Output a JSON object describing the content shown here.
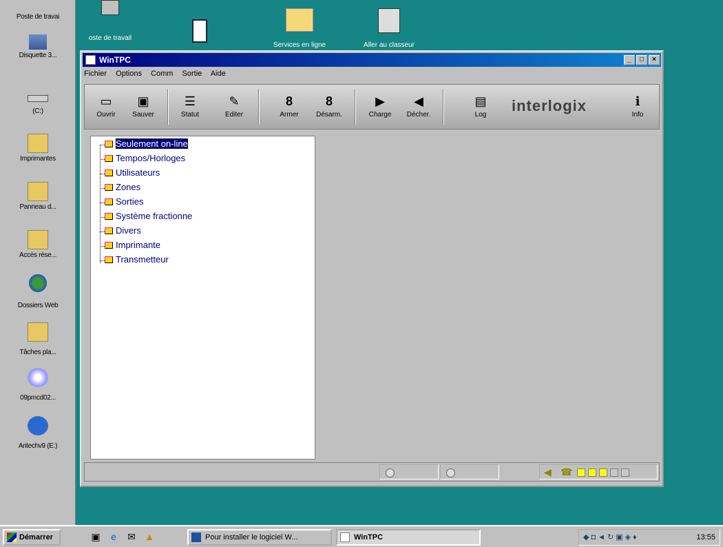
{
  "desktop_icons": [
    {
      "label": "Poste de travai",
      "icon": "computer-icon"
    },
    {
      "label": "Disquette 3...",
      "icon": "floppy-icon"
    },
    {
      "label": "(C:)",
      "icon": "drive-icon"
    },
    {
      "label": "Imprimantes",
      "icon": "printers-icon"
    },
    {
      "label": "Panneau d...",
      "icon": "control-panel-icon"
    },
    {
      "label": "Accès rése...",
      "icon": "network-icon"
    },
    {
      "label": "Dossiers Web",
      "icon": "web-folders-icon"
    },
    {
      "label": "Tâches pla...",
      "icon": "scheduled-tasks-icon"
    },
    {
      "label": "09pmcd02...",
      "icon": "cd-icon"
    },
    {
      "label": "Aritechv9 (E:)",
      "icon": "aritech-drive-icon"
    }
  ],
  "top_icons": [
    {
      "label": "oste de travail",
      "icon": "computer-icon"
    },
    {
      "label": "",
      "icon": "tool-icon"
    },
    {
      "label": "Services en ligne",
      "icon": "folder-icon"
    },
    {
      "label": "Aller au classeur",
      "icon": "briefcase-icon"
    }
  ],
  "window": {
    "title": "WinTPC",
    "menu": [
      "Fichier",
      "Options",
      "Comm",
      "Sortie",
      "Aide"
    ],
    "toolbar": [
      {
        "label": "Ouvrir",
        "glyph": "▭"
      },
      {
        "label": "Sauver",
        "glyph": "▣"
      },
      {
        "label": "Statut",
        "glyph": "☰"
      },
      {
        "label": "Editer",
        "glyph": "✎"
      },
      {
        "label": "Armer",
        "glyph": "8"
      },
      {
        "label": "Désarm.",
        "glyph": "8"
      },
      {
        "label": "Charge",
        "glyph": "▶"
      },
      {
        "label": "Décher.",
        "glyph": "◀"
      },
      {
        "label": "Log",
        "glyph": "▤"
      },
      {
        "label": "Info",
        "glyph": "ℹ"
      }
    ],
    "logo": "interlogix",
    "tree": [
      "Seulement on-line",
      "Tempos/Horloges",
      "Utilisateurs",
      "Zones",
      "Sorties",
      "Système fractionne",
      "Divers",
      "Imprimante",
      "Transmetteur"
    ],
    "selected_index": 0,
    "leds": [
      true,
      true,
      true,
      false,
      false
    ]
  },
  "taskbar": {
    "start": "Démarrer",
    "tasks": [
      "Pour installer le logiciel W...",
      "WinTPC"
    ],
    "clock": "13:55"
  }
}
